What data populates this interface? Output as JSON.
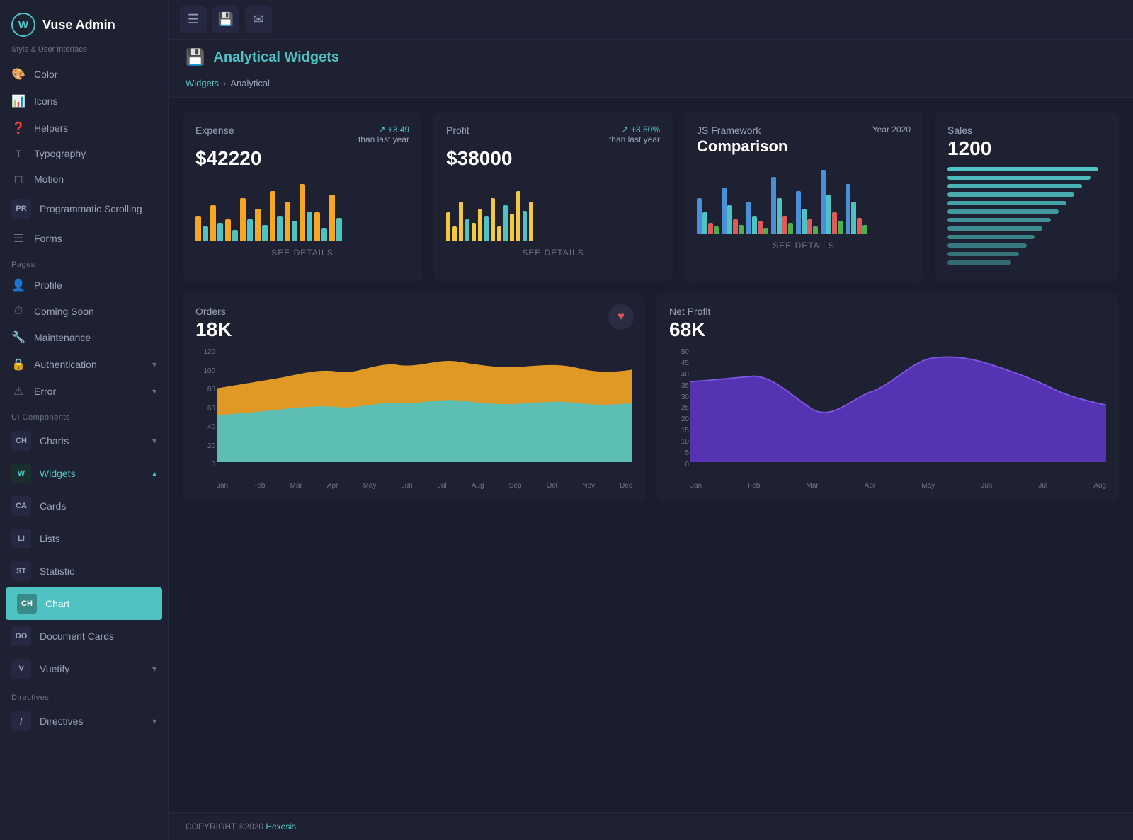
{
  "app": {
    "title": "Vuse Admin",
    "subtitle": "Style & User Interface"
  },
  "sidebar": {
    "style_section": "Style & User Interface",
    "style_items": [
      {
        "label": "Color",
        "icon": "🎨",
        "type": "icon"
      },
      {
        "label": "Icons",
        "icon": "📊",
        "type": "icon"
      },
      {
        "label": "Helpers",
        "icon": "❓",
        "type": "icon"
      },
      {
        "label": "Typography",
        "icon": "T",
        "type": "text"
      },
      {
        "label": "Motion",
        "icon": "□",
        "type": "icon"
      },
      {
        "label": "Programmatic Scrolling",
        "icon": "PR",
        "type": "prefix"
      },
      {
        "label": "Forms",
        "icon": "☰",
        "type": "icon"
      }
    ],
    "pages_section": "Pages",
    "pages_items": [
      {
        "label": "Profile",
        "icon": "👤",
        "type": "icon"
      },
      {
        "label": "Coming Soon",
        "icon": "⏱",
        "type": "icon"
      },
      {
        "label": "Maintenance",
        "icon": "🔧",
        "type": "icon"
      },
      {
        "label": "Authentication",
        "icon": "🔒",
        "type": "icon",
        "has_chevron": true
      },
      {
        "label": "Error",
        "icon": "⚠",
        "type": "icon",
        "has_chevron": true
      }
    ],
    "ui_section": "UI Components",
    "ui_items": [
      {
        "label": "Charts",
        "prefix": "CH",
        "has_chevron": true
      },
      {
        "label": "Widgets",
        "prefix": "W",
        "active": false,
        "expanded": true,
        "color": "#4fc3c3"
      },
      {
        "label": "Cards",
        "prefix": "CA"
      },
      {
        "label": "Lists",
        "prefix": "LI"
      },
      {
        "label": "Statistic",
        "prefix": "ST"
      },
      {
        "label": "Chart",
        "prefix": "CH",
        "active": true
      },
      {
        "label": "Document Cards",
        "prefix": "DO"
      },
      {
        "label": "Vuetify",
        "prefix": "V",
        "has_chevron": true
      }
    ],
    "directives_section": "Directives",
    "directives_items": [
      {
        "label": "Directives",
        "icon": "f",
        "has_chevron": true
      }
    ]
  },
  "topbar": {
    "buttons": [
      "☰",
      "💾",
      "✉"
    ]
  },
  "page": {
    "icon": "💾",
    "title": "Analytical Widgets",
    "breadcrumb_home": "Widgets",
    "breadcrumb_sep": "›",
    "breadcrumb_current": "Analytical"
  },
  "widgets": {
    "expense": {
      "title": "Expense",
      "value": "$42220",
      "badge": "+3.49",
      "subtitle": "than last year",
      "cta": "SEE DETAILS"
    },
    "profit": {
      "title": "Profit",
      "value": "$38000",
      "badge": "+8.50%",
      "subtitle": "than last year",
      "cta": "SEE DETAILS"
    },
    "jsframework": {
      "title": "JS Framework",
      "subtitle": "Comparison",
      "year": "Year 2020",
      "cta": "SEE DETAILS"
    },
    "sales": {
      "title": "Sales",
      "value": "1200"
    }
  },
  "orders": {
    "title": "Orders",
    "value": "18K",
    "y_labels": [
      "120",
      "100",
      "80",
      "60",
      "40",
      "20",
      "0"
    ],
    "x_labels": [
      "Jan",
      "Feb",
      "Mar",
      "Apr",
      "May",
      "Jun",
      "Jul",
      "Aug",
      "Sep",
      "Oct",
      "Nov",
      "Dec"
    ]
  },
  "net_profit": {
    "title": "Net Profit",
    "value": "68K",
    "y_labels": [
      "50",
      "45",
      "40",
      "35",
      "30",
      "25",
      "20",
      "15",
      "10",
      "5",
      "0"
    ],
    "x_labels": [
      "Jan",
      "Feb",
      "Mar",
      "Apr",
      "May",
      "Jun",
      "Jul",
      "Aug"
    ]
  },
  "footer": {
    "text": "COPYRIGHT ©2020",
    "link": "Hexesis"
  }
}
